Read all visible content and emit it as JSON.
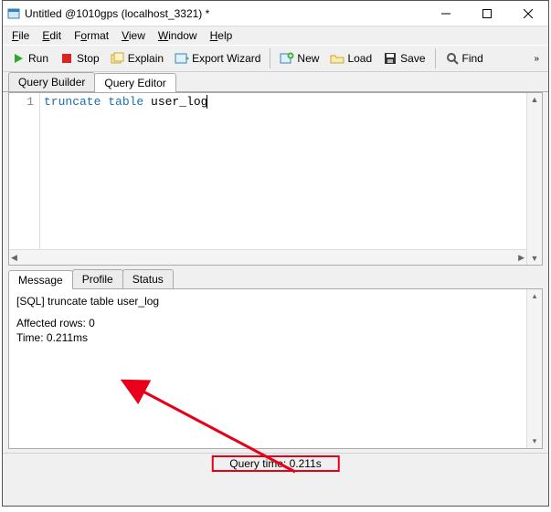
{
  "titlebar": {
    "title": "Untitled @1010gps (localhost_3321) *"
  },
  "menu": {
    "file": "File",
    "edit": "Edit",
    "format": "Format",
    "view": "View",
    "window": "Window",
    "help": "Help"
  },
  "toolbar": {
    "run": "Run",
    "stop": "Stop",
    "explain": "Explain",
    "export_wizard": "Export Wizard",
    "new": "New",
    "load": "Load",
    "save": "Save",
    "find": "Find"
  },
  "tabs": {
    "query_builder": "Query Builder",
    "query_editor": "Query Editor",
    "active_index": 1
  },
  "editor": {
    "gutter": [
      "1"
    ],
    "code_kw": "truncate table",
    "code_rest": " user_log"
  },
  "result_tabs": {
    "message": "Message",
    "profile": "Profile",
    "status": "Status",
    "active_index": 0
  },
  "message_panel": {
    "line1": "[SQL] truncate table user_log",
    "line2": "Affected rows: 0",
    "line3": "Time: 0.211ms"
  },
  "statusbar": {
    "query_time": "Query time: 0.211s"
  }
}
